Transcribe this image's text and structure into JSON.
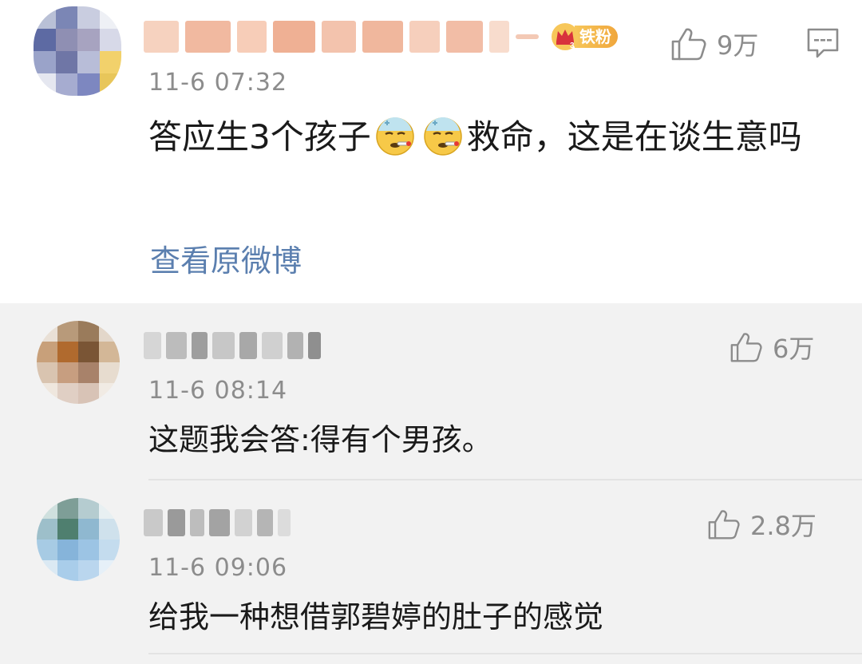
{
  "main_comment": {
    "badge_label": "铁粉",
    "likes": "9万",
    "time": "11-6 07:32",
    "text_before_emoji": "答应生3个孩子",
    "text_after_emoji": "救命，这是在谈生意吗",
    "view_original": "查看原微博"
  },
  "replies": [
    {
      "likes": "6万",
      "time": "11-6 08:14",
      "text": "这题我会答:得有个男孩。"
    },
    {
      "likes": "2.8万",
      "time": "11-6 09:06",
      "text": "给我一种想借郭碧婷的肚子的感觉"
    }
  ],
  "colors": {
    "link": "#5b7faf",
    "meta_gray": "#8c8c8c",
    "badge_gold": "#f0a63c",
    "reply_background": "#f2f2f2"
  },
  "icons": {
    "like": "thumbs-up-icon",
    "comment": "comment-bubble-icon",
    "badge": "crown-icon",
    "emoji": "sick-thermometer-face"
  }
}
